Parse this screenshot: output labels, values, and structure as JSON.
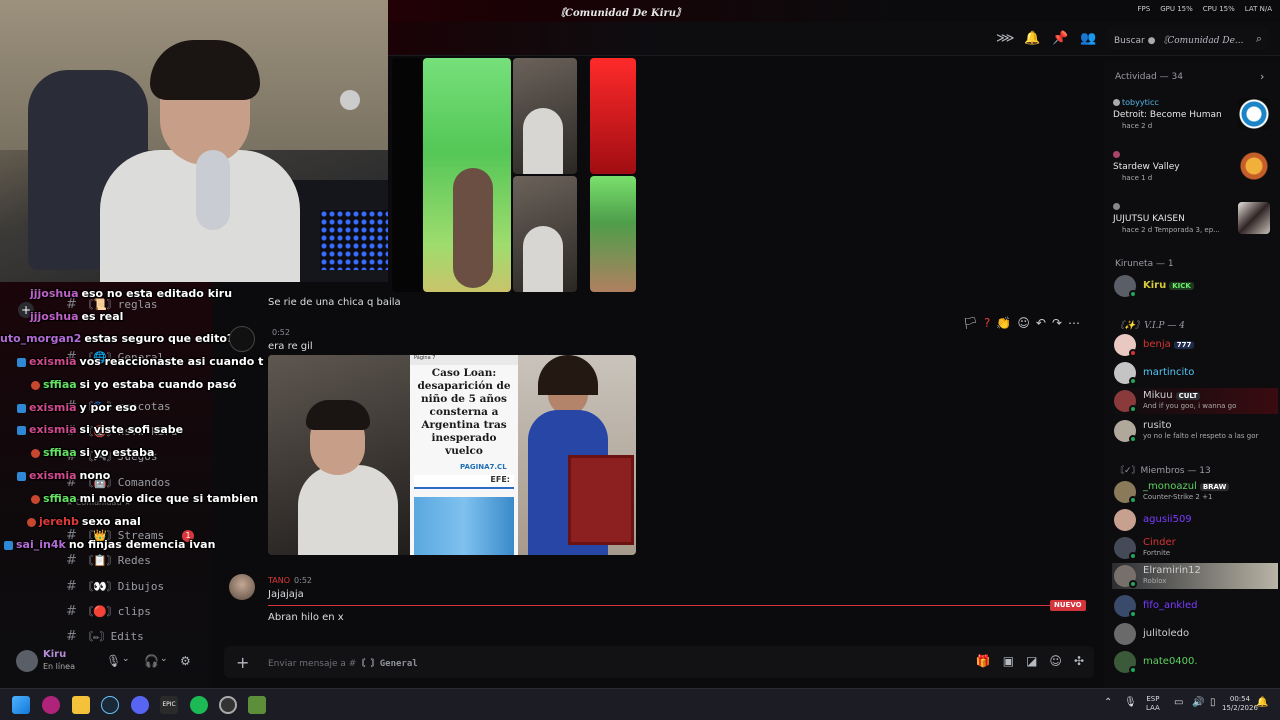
{
  "titlebar": {
    "server_title": "〘Comunidad De Kiru〙",
    "stats": [
      "FPS",
      "GPU 15%",
      "CPU 15%",
      "LAT N/A"
    ]
  },
  "header": {
    "search_placeholder": "Buscar",
    "search_server": "〘Comunidad De..."
  },
  "sidebar": {
    "channels": [
      {
        "label": "reglas",
        "icon": "book-icon"
      },
      {
        "label": "General",
        "icon": "globe-icon"
      },
      {
        "label": "mascotas",
        "icon": "paw-icon"
      },
      {
        "label": "nsfw-kiru",
        "icon": "nsfw-icon"
      },
      {
        "label": "Juegos",
        "icon": "gamepad-icon"
      },
      {
        "label": "Comandos",
        "icon": "bot-icon"
      },
      {
        "label": "Streams",
        "icon": "crown-icon",
        "badge": "1"
      },
      {
        "label": "Redes",
        "icon": "grid-icon"
      },
      {
        "label": "Dibujos",
        "icon": "eyes-icon"
      },
      {
        "label": "clips",
        "icon": "record-icon"
      },
      {
        "label": "Edits",
        "icon": "edit-icon"
      }
    ],
    "category": "★ Comunidad ★"
  },
  "chat_overlay": [
    {
      "user": "jjjoshua",
      "text": "eso no esta editado kiru",
      "color": "#c060c8"
    },
    {
      "user": "jjjoshua",
      "text": "es real",
      "color": "#c060c8"
    },
    {
      "user": "uto_morgan2",
      "text": "estas seguro que edito?",
      "color": "#b46bd6"
    },
    {
      "user": "exismia",
      "text": "vos reaccionaste asi cuando t mandaron el link",
      "color": "#d34a8e"
    },
    {
      "user": "sffiaa",
      "text": "si yo estaba cuando pasó",
      "color": "#65e065"
    },
    {
      "user": "exismia",
      "text": "y por eso",
      "color": "#d34a8e"
    },
    {
      "user": "exismia",
      "text": "si viste sofi sabe",
      "color": "#d34a8e"
    },
    {
      "user": "sffiaa",
      "text": "si yo estaba",
      "color": "#65e065"
    },
    {
      "user": "exismia",
      "text": "nono",
      "color": "#d34a8e"
    },
    {
      "user": "sffiaa",
      "text": "mi novio dice que si tambien",
      "color": "#65e065"
    },
    {
      "user": "jerehb",
      "text": "sexo anal",
      "color": "#e23a3a"
    },
    {
      "user": "sai_in4k",
      "text": "no finjas demencia ivan",
      "color": "#b46bd6"
    }
  ],
  "user_panel": {
    "name": "Kiru",
    "status": "En línea"
  },
  "messages": {
    "caption1": "Se rie de una chica q baila",
    "msg2_author": "",
    "msg2_time": "0:52",
    "msg2_text": "era re gil",
    "news": {
      "site": "Página 7",
      "headline": "Caso Loan: desaparición de niño de 5 años consterna a Argentina tras inesperado vuelco",
      "brand": "PAGINA7.CL",
      "tag": "EFE:"
    },
    "msg3_author": "TANO",
    "msg3_time": "0:52",
    "msg3_text": "Jajajaja",
    "msg4_text": "Abran hilo en x",
    "new_label": "NUEVO"
  },
  "composer": {
    "placeholder_prefix": "Enviar mensaje a #",
    "channel": "〘 〙General"
  },
  "members": {
    "activity_label": "Actividad — 34",
    "activities": [
      {
        "user": "tobyyticc",
        "game": "Detroit: Become Human",
        "sub": "hace 2 d",
        "color": "#52b6e6"
      },
      {
        "user": "",
        "game": "Stardew Valley",
        "sub": "hace 1 d",
        "color": "#7a3cff"
      },
      {
        "user": "",
        "game": "JUJUTSU KAISEN",
        "sub": "hace 2 d   Temporada 3, ep...",
        "color": "#7a3cff"
      }
    ],
    "kiruneta_label": "Kiruneta — 1",
    "kiru": {
      "name": "Kiru",
      "tag": "KICK"
    },
    "vip_label": "〘✨〙V.I.P — 4",
    "vip": [
      {
        "name": "benja",
        "tag": "777",
        "color": "#d6342f"
      },
      {
        "name": "martincito",
        "color": "#52c7f5"
      },
      {
        "name": "Mikuu",
        "tag": "CULT",
        "sub": "And if you goo, i wanna go",
        "color": "#cfcfcf"
      },
      {
        "name": "rusito",
        "sub": "yo no le falto el respeto a las gor",
        "color": "#cfcfcf"
      }
    ],
    "members_label": "〘✓〙Miembros — 13",
    "members": [
      {
        "name": "_monoazul",
        "tag": "BRAW",
        "sub": "Counter-Strike 2 +1",
        "color": "#5fd15f"
      },
      {
        "name": "agusii509",
        "color": "#7a3cff"
      },
      {
        "name": "Cinder",
        "sub": "Fortnite",
        "color": "#d6342f"
      },
      {
        "name": "Elramirin12",
        "sub": "Roblox",
        "color": "#cfcfcf"
      },
      {
        "name": "fifo_ankled",
        "color": "#7a3cff"
      },
      {
        "name": "julitoledo",
        "color": "#cfcfcf"
      },
      {
        "name": "mate0400.",
        "color": "#5fd15f"
      }
    ]
  },
  "taskbar": {
    "lang": "ESP\nLAA",
    "time": "00:54",
    "date": "15/2/2026"
  }
}
